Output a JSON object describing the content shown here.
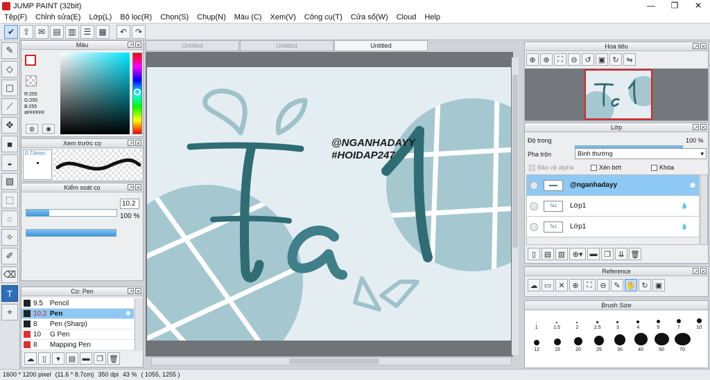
{
  "window": {
    "title": "JUMP PAINT (32bit)"
  },
  "menu": [
    "Tệp(F)",
    "Chỉnh sửa(E)",
    "Lớp(L)",
    "Bộ lọc(R)",
    "Chọn(S)",
    "Chụp(N)",
    "Màu (C)",
    "Xem(V)",
    "Công cụ(T)",
    "Cửa sổ(W)",
    "Cloud",
    "Help"
  ],
  "color_panel": {
    "title": "Màu",
    "r": "R:255",
    "g": "G:255",
    "b": "B:255",
    "hex": "#FFFFFF"
  },
  "preview_panel": {
    "title": "Xem trước cọ",
    "size": "0.74mm"
  },
  "brush_control": {
    "title": "Kiểm soát cọ",
    "size_value": "10.2",
    "size_fill": 0.25,
    "opacity_value": "100 %",
    "opacity_fill": 1.0
  },
  "brush_list": {
    "title": "Cọ: Pen",
    "items": [
      {
        "size": "9.5",
        "name": "Pencil",
        "color": "#222222",
        "selected": false
      },
      {
        "size": "10.2",
        "name": "Pen",
        "color": "#222222",
        "selected": true
      },
      {
        "size": "8",
        "name": "Pen (Sharp)",
        "color": "#222222",
        "selected": false
      },
      {
        "size": "10",
        "name": "G Pen",
        "color": "#e03030",
        "selected": false
      },
      {
        "size": "8",
        "name": "Mapping Pen",
        "color": "#e03030",
        "selected": false
      }
    ]
  },
  "tabs": [
    {
      "label": "Untitled",
      "active": false
    },
    {
      "label": "Untitled",
      "active": false
    },
    {
      "label": "Untitled",
      "active": true
    }
  ],
  "canvas": {
    "watermark1": "@NGANHADAYY",
    "watermark2": "#HOIDAP247"
  },
  "navigator": {
    "title": "Hoa tiêu"
  },
  "layer_panel": {
    "title": "Lớp",
    "opacity_label": "Độ trong",
    "opacity_value": "100 %",
    "opacity_fill": 1.0,
    "blend_label": "Pha trộn",
    "blend_value": "Bình thường",
    "protect_alpha": "Bảo vệ alpha",
    "clip": "Xén bớt",
    "lock": "Khóa",
    "layers": [
      {
        "name": "@nganhadayy",
        "selected": true
      },
      {
        "name": "Lớp1",
        "selected": false
      },
      {
        "name": "Lớp1",
        "selected": false
      }
    ]
  },
  "reference_panel": {
    "title": "Reference"
  },
  "brush_size_panel": {
    "title": "Brush Size",
    "row1": [
      "1",
      "1.5",
      "2",
      "2.5",
      "3",
      "4",
      "5",
      "7",
      "10"
    ],
    "row2": [
      "12",
      "15",
      "20",
      "25",
      "30",
      "40",
      "50",
      "70"
    ]
  },
  "status": {
    "size": "1600 * 1200 pixel",
    "physical": "(11.6 * 8.7cm)",
    "dpi": "350 dpi",
    "zoom": "43 %",
    "coords": "( 1055, 1255 )"
  },
  "colors": {
    "accent": "#3d96de",
    "selected_row": "#8dc9f4",
    "art": "#2f6c74",
    "art_light": "#8fbcc4",
    "canvas_bg": "#e4eef2"
  }
}
